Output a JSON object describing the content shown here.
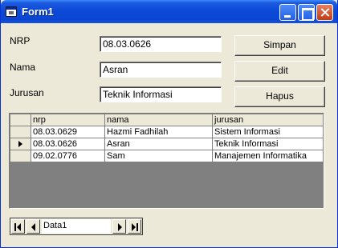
{
  "window": {
    "title": "Form1"
  },
  "form": {
    "nrp_label": "NRP",
    "nrp_value": "08.03.0626",
    "nama_label": "Nama",
    "nama_value": "Asran",
    "jurusan_label": "Jurusan",
    "jurusan_value": "Teknik Informasi"
  },
  "buttons": {
    "simpan": "Simpan",
    "edit": "Edit",
    "hapus": "Hapus"
  },
  "grid": {
    "columns": [
      "nrp",
      "nama",
      "jurusan"
    ],
    "rows": [
      {
        "nrp": "08.03.0629",
        "nama": "Hazmi Fadhilah",
        "jurusan": "Sistem Informasi",
        "current": false
      },
      {
        "nrp": "08.03.0626",
        "nama": "Asran",
        "jurusan": "Teknik Informasi",
        "current": true
      },
      {
        "nrp": "09.02.0776",
        "nama": "Sam",
        "jurusan": "Manajemen Informatika",
        "current": false
      }
    ]
  },
  "data_control": {
    "caption": "Data1"
  },
  "icons": {
    "title": "form-window-icon",
    "current_row": "row-pointer-icon"
  },
  "colors": {
    "titlebar": "#0a48d6",
    "close": "#c33b17",
    "face": "#ece9d8"
  }
}
